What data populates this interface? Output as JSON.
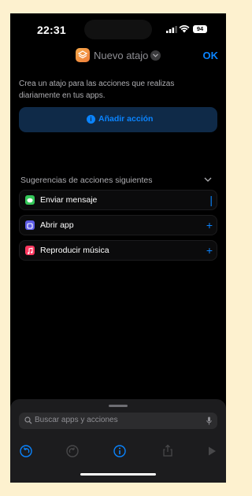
{
  "status": {
    "time": "22:31",
    "battery": "94"
  },
  "nav": {
    "title": "Nuevo atajo",
    "done_label": "OK"
  },
  "description": "Crea un atajo para las acciones que realizas diariamente en tus apps.",
  "add_action_label": "Añadir acción",
  "suggestions": {
    "header": "Sugerencias de acciones siguientes",
    "items": [
      {
        "label": "Enviar mensaje",
        "icon": "messages-icon",
        "color": "#34c759"
      },
      {
        "label": "Abrir app",
        "icon": "open-app-icon",
        "color": "#5e5ce6"
      },
      {
        "label": "Reproducir música",
        "icon": "music-icon",
        "color": "#ff375f"
      }
    ]
  },
  "search": {
    "placeholder": "Buscar apps y acciones"
  },
  "colors": {
    "accent": "#0a84ff",
    "background": "#000000",
    "sheet": "#1c1c1e"
  }
}
